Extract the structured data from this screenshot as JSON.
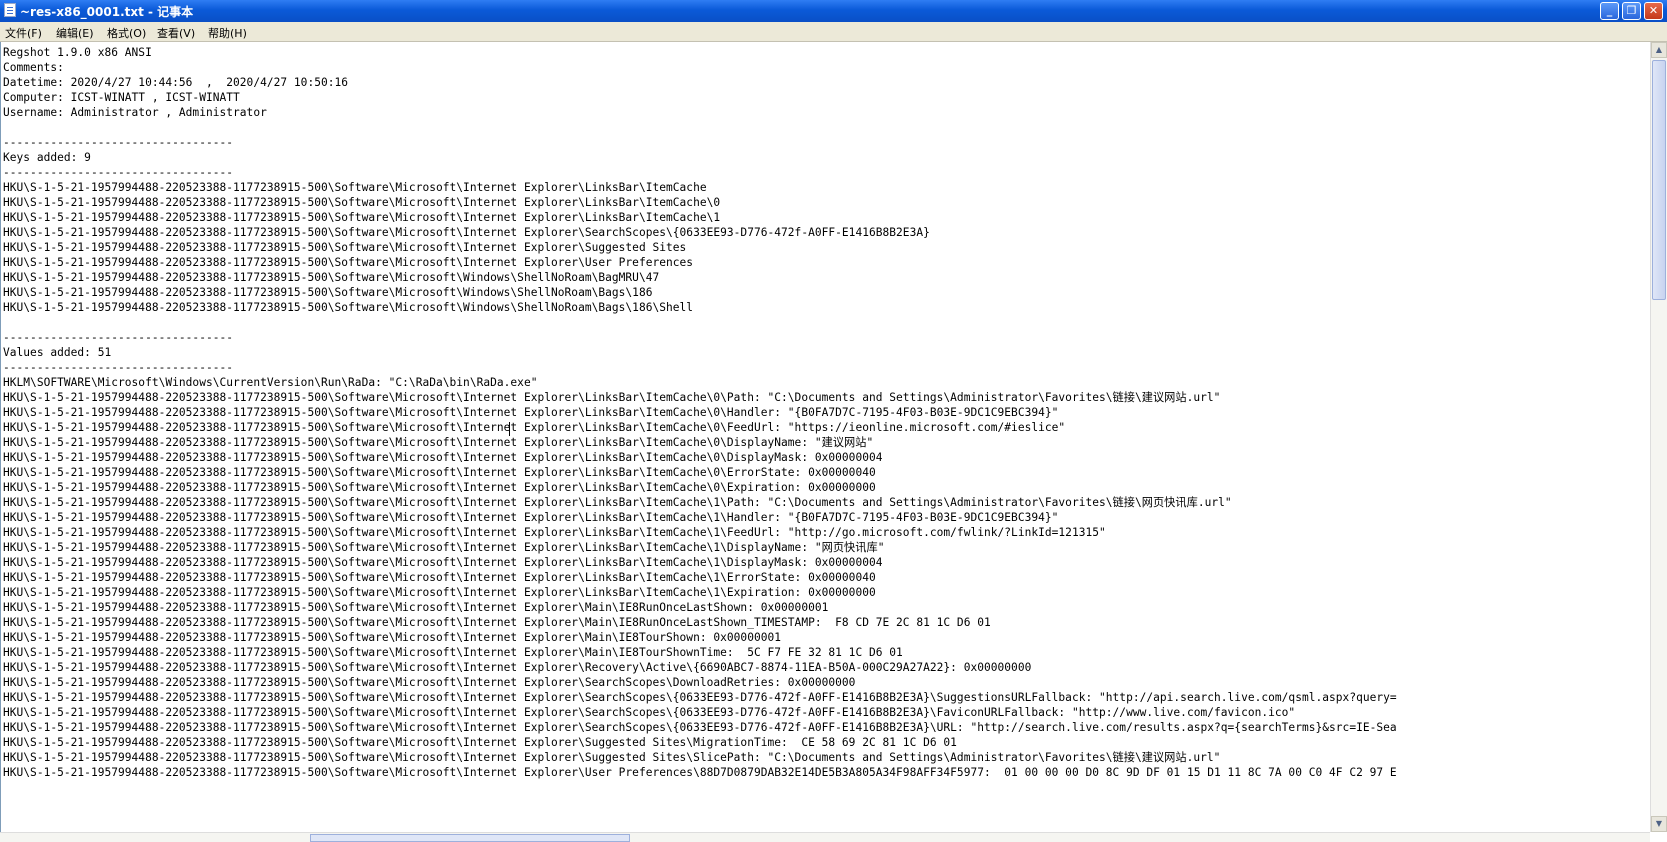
{
  "window": {
    "title": "~res-x86_0001.txt - 记事本",
    "minimize_label": "_",
    "maximize_label": "❐",
    "close_label": "✕"
  },
  "menu": [
    "文件(F)",
    "编辑(E)",
    "格式(O)",
    "查看(V)",
    "帮助(H)"
  ],
  "lines": [
    "Regshot 1.9.0 x86 ANSI",
    "Comments:",
    "Datetime: 2020/4/27 10:44:56  ,  2020/4/27 10:50:16",
    "Computer: ICST-WINATT , ICST-WINATT",
    "Username: Administrator , Administrator",
    "",
    "----------------------------------",
    "Keys added: 9",
    "----------------------------------",
    "HKU\\S-1-5-21-1957994488-220523388-1177238915-500\\Software\\Microsoft\\Internet Explorer\\LinksBar\\ItemCache",
    "HKU\\S-1-5-21-1957994488-220523388-1177238915-500\\Software\\Microsoft\\Internet Explorer\\LinksBar\\ItemCache\\0",
    "HKU\\S-1-5-21-1957994488-220523388-1177238915-500\\Software\\Microsoft\\Internet Explorer\\LinksBar\\ItemCache\\1",
    "HKU\\S-1-5-21-1957994488-220523388-1177238915-500\\Software\\Microsoft\\Internet Explorer\\SearchScopes\\{0633EE93-D776-472f-A0FF-E1416B8B2E3A}",
    "HKU\\S-1-5-21-1957994488-220523388-1177238915-500\\Software\\Microsoft\\Internet Explorer\\Suggested Sites",
    "HKU\\S-1-5-21-1957994488-220523388-1177238915-500\\Software\\Microsoft\\Internet Explorer\\User Preferences",
    "HKU\\S-1-5-21-1957994488-220523388-1177238915-500\\Software\\Microsoft\\Windows\\ShellNoRoam\\BagMRU\\47",
    "HKU\\S-1-5-21-1957994488-220523388-1177238915-500\\Software\\Microsoft\\Windows\\ShellNoRoam\\Bags\\186",
    "HKU\\S-1-5-21-1957994488-220523388-1177238915-500\\Software\\Microsoft\\Windows\\ShellNoRoam\\Bags\\186\\Shell",
    "",
    "----------------------------------",
    "Values added: 51",
    "----------------------------------",
    "HKLM\\SOFTWARE\\Microsoft\\Windows\\CurrentVersion\\Run\\RaDa: \"C:\\RaDa\\bin\\RaDa.exe\"",
    "HKU\\S-1-5-21-1957994488-220523388-1177238915-500\\Software\\Microsoft\\Internet Explorer\\LinksBar\\ItemCache\\0\\Path: \"C:\\Documents and Settings\\Administrator\\Favorites\\链接\\建议网站.url\"",
    "HKU\\S-1-5-21-1957994488-220523388-1177238915-500\\Software\\Microsoft\\Internet Explorer\\LinksBar\\ItemCache\\0\\Handler: \"{B0FA7D7C-7195-4F03-B03E-9DC1C9EBC394}\"",
    "HKU\\S-1-5-21-1957994488-220523388-1177238915-500\\Software\\Microsoft\\Internet Explorer\\LinksBar\\ItemCache\\0\\FeedUrl: \"https://ieonline.microsoft.com/#ieslice\"",
    "HKU\\S-1-5-21-1957994488-220523388-1177238915-500\\Software\\Microsoft\\Internet Explorer\\LinksBar\\ItemCache\\0\\DisplayName: \"建议网站\"",
    "HKU\\S-1-5-21-1957994488-220523388-1177238915-500\\Software\\Microsoft\\Internet Explorer\\LinksBar\\ItemCache\\0\\DisplayMask: 0x00000004",
    "HKU\\S-1-5-21-1957994488-220523388-1177238915-500\\Software\\Microsoft\\Internet Explorer\\LinksBar\\ItemCache\\0\\ErrorState: 0x00000040",
    "HKU\\S-1-5-21-1957994488-220523388-1177238915-500\\Software\\Microsoft\\Internet Explorer\\LinksBar\\ItemCache\\0\\Expiration: 0x00000000",
    "HKU\\S-1-5-21-1957994488-220523388-1177238915-500\\Software\\Microsoft\\Internet Explorer\\LinksBar\\ItemCache\\1\\Path: \"C:\\Documents and Settings\\Administrator\\Favorites\\链接\\网页快讯库.url\"",
    "HKU\\S-1-5-21-1957994488-220523388-1177238915-500\\Software\\Microsoft\\Internet Explorer\\LinksBar\\ItemCache\\1\\Handler: \"{B0FA7D7C-7195-4F03-B03E-9DC1C9EBC394}\"",
    "HKU\\S-1-5-21-1957994488-220523388-1177238915-500\\Software\\Microsoft\\Internet Explorer\\LinksBar\\ItemCache\\1\\FeedUrl: \"http://go.microsoft.com/fwlink/?LinkId=121315\"",
    "HKU\\S-1-5-21-1957994488-220523388-1177238915-500\\Software\\Microsoft\\Internet Explorer\\LinksBar\\ItemCache\\1\\DisplayName: \"网页快讯库\"",
    "HKU\\S-1-5-21-1957994488-220523388-1177238915-500\\Software\\Microsoft\\Internet Explorer\\LinksBar\\ItemCache\\1\\DisplayMask: 0x00000004",
    "HKU\\S-1-5-21-1957994488-220523388-1177238915-500\\Software\\Microsoft\\Internet Explorer\\LinksBar\\ItemCache\\1\\ErrorState: 0x00000040",
    "HKU\\S-1-5-21-1957994488-220523388-1177238915-500\\Software\\Microsoft\\Internet Explorer\\LinksBar\\ItemCache\\1\\Expiration: 0x00000000",
    "HKU\\S-1-5-21-1957994488-220523388-1177238915-500\\Software\\Microsoft\\Internet Explorer\\Main\\IE8RunOnceLastShown: 0x00000001",
    "HKU\\S-1-5-21-1957994488-220523388-1177238915-500\\Software\\Microsoft\\Internet Explorer\\Main\\IE8RunOnceLastShown_TIMESTAMP:  F8 CD 7E 2C 81 1C D6 01",
    "HKU\\S-1-5-21-1957994488-220523388-1177238915-500\\Software\\Microsoft\\Internet Explorer\\Main\\IE8TourShown: 0x00000001",
    "HKU\\S-1-5-21-1957994488-220523388-1177238915-500\\Software\\Microsoft\\Internet Explorer\\Main\\IE8TourShownTime:  5C F7 FE 32 81 1C D6 01",
    "HKU\\S-1-5-21-1957994488-220523388-1177238915-500\\Software\\Microsoft\\Internet Explorer\\Recovery\\Active\\{6690ABC7-8874-11EA-B50A-000C29A27A22}: 0x00000000",
    "HKU\\S-1-5-21-1957994488-220523388-1177238915-500\\Software\\Microsoft\\Internet Explorer\\SearchScopes\\DownloadRetries: 0x00000000",
    "HKU\\S-1-5-21-1957994488-220523388-1177238915-500\\Software\\Microsoft\\Internet Explorer\\SearchScopes\\{0633EE93-D776-472f-A0FF-E1416B8B2E3A}\\SuggestionsURLFallback: \"http://api.search.live.com/qsml.aspx?query=",
    "HKU\\S-1-5-21-1957994488-220523388-1177238915-500\\Software\\Microsoft\\Internet Explorer\\SearchScopes\\{0633EE93-D776-472f-A0FF-E1416B8B2E3A}\\FaviconURLFallback: \"http://www.live.com/favicon.ico\"",
    "HKU\\S-1-5-21-1957994488-220523388-1177238915-500\\Software\\Microsoft\\Internet Explorer\\SearchScopes\\{0633EE93-D776-472f-A0FF-E1416B8B2E3A}\\URL: \"http://search.live.com/results.aspx?q={searchTerms}&src=IE-Sea",
    "HKU\\S-1-5-21-1957994488-220523388-1177238915-500\\Software\\Microsoft\\Internet Explorer\\Suggested Sites\\MigrationTime:  CE 58 69 2C 81 1C D6 01",
    "HKU\\S-1-5-21-1957994488-220523388-1177238915-500\\Software\\Microsoft\\Internet Explorer\\Suggested Sites\\SlicePath: \"C:\\Documents and Settings\\Administrator\\Favorites\\链接\\建议网站.url\"",
    "HKU\\S-1-5-21-1957994488-220523388-1177238915-500\\Software\\Microsoft\\Internet Explorer\\User Preferences\\88D7D0879DAB32E14DE5B3A805A34F98AFF34F5977:  01 00 00 00 D0 8C 9D DF 01 15 D1 11 8C 7A 00 C0 4F C2 97 E"
  ]
}
